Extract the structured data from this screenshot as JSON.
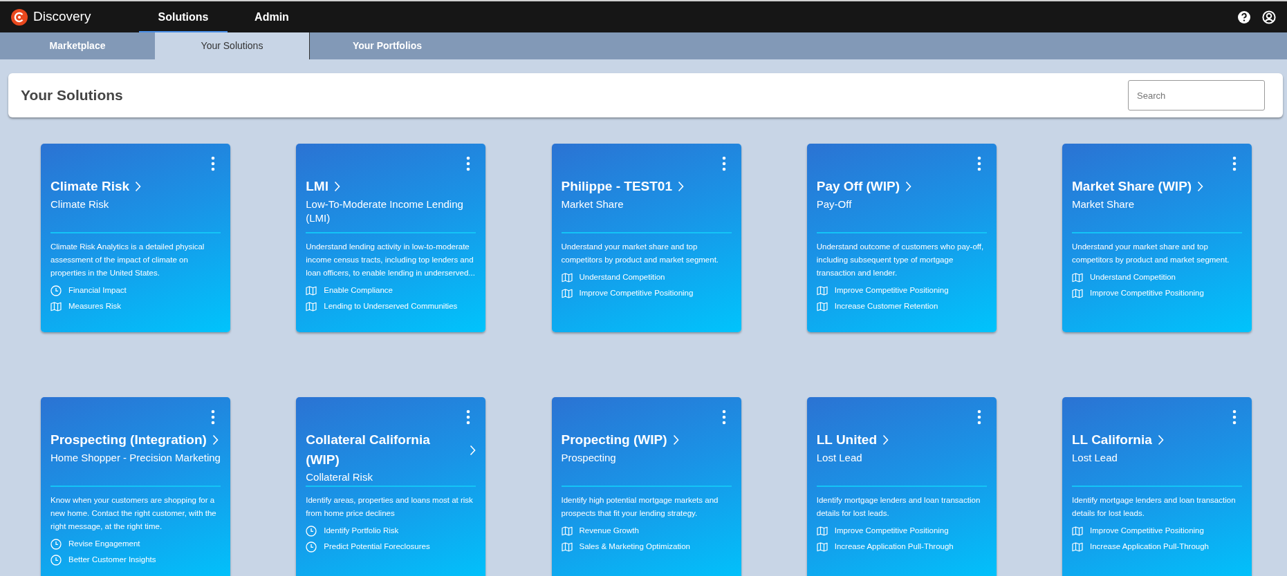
{
  "app": {
    "name": "Discovery"
  },
  "top_nav": [
    {
      "label": "Solutions",
      "selected": true
    },
    {
      "label": "Admin",
      "selected": false
    }
  ],
  "sub_tabs": [
    {
      "label": "Marketplace",
      "selected": false
    },
    {
      "label": "Your Solutions",
      "selected": true
    },
    {
      "label": "Your Portfolios",
      "selected": false
    }
  ],
  "page": {
    "title": "Your Solutions",
    "search": {
      "placeholder": "Search"
    }
  },
  "cards": [
    {
      "title": "Climate Risk",
      "subtitle": "Climate Risk",
      "description": "Climate Risk Analytics is a detailed physical assessment of the impact of climate on properties in the United States.",
      "features": [
        {
          "kind": "clock",
          "label": "Financial Impact"
        },
        {
          "kind": "map",
          "label": "Measures Risk"
        }
      ]
    },
    {
      "title": "LMI",
      "subtitle": "Low-To-Moderate Income Lending (LMI)",
      "description": "Understand lending activity in low-to-moderate income census tracts, including top lenders and loan officers, to enable lending in underserved...",
      "features": [
        {
          "kind": "map",
          "label": "Enable Compliance"
        },
        {
          "kind": "map",
          "label": "Lending to Underserved Communities"
        }
      ]
    },
    {
      "title": "Philippe - TEST01",
      "subtitle": "Market Share",
      "description": "Understand your market share and top competitors by product and market segment.",
      "features": [
        {
          "kind": "map",
          "label": "Understand Competition"
        },
        {
          "kind": "map",
          "label": "Improve Competitive Positioning"
        }
      ]
    },
    {
      "title": "Pay Off (WIP)",
      "subtitle": "Pay-Off",
      "description": "Understand outcome of customers who pay-off, including subsequent type of mortgage transaction and lender.",
      "features": [
        {
          "kind": "map",
          "label": "Improve Competitive Positioning"
        },
        {
          "kind": "map",
          "label": "Increase Customer Retention"
        }
      ]
    },
    {
      "title": "Market Share (WIP)",
      "subtitle": "Market Share",
      "description": "Understand your market share and top competitors by product and market segment.",
      "features": [
        {
          "kind": "map",
          "label": "Understand Competition"
        },
        {
          "kind": "map",
          "label": "Improve Competitive Positioning"
        }
      ]
    },
    {
      "title": "Prospecting (Integration)",
      "subtitle": "Home Shopper - Precision Marketing",
      "description": "Know when your customers are shopping for a new home. Contact the right customer, with the right message, at the right time.",
      "features": [
        {
          "kind": "clock",
          "label": "Revise Engagement"
        },
        {
          "kind": "clock",
          "label": "Better Customer Insights"
        }
      ]
    },
    {
      "title": "Collateral California (WIP)",
      "subtitle": "Collateral Risk",
      "description": "Identify areas, properties and loans most at risk from home price declines",
      "features": [
        {
          "kind": "clock",
          "label": "Identify Portfolio Risk"
        },
        {
          "kind": "clock",
          "label": "Predict Potential Foreclosures"
        }
      ]
    },
    {
      "title": "Propecting (WIP)",
      "subtitle": "Prospecting",
      "description": "Identify high potential mortgage markets and prospects that fit your lending strategy.",
      "features": [
        {
          "kind": "map",
          "label": "Revenue Growth"
        },
        {
          "kind": "map",
          "label": "Sales & Marketing Optimization"
        }
      ]
    },
    {
      "title": "LL United",
      "subtitle": "Lost Lead",
      "description": "Identify mortgage lenders and loan transaction details for lost leads.",
      "features": [
        {
          "kind": "map",
          "label": "Improve Competitive Positioning"
        },
        {
          "kind": "map",
          "label": "Increase Application Pull-Through"
        }
      ]
    },
    {
      "title": "LL California",
      "subtitle": "Lost Lead",
      "description": "Identify mortgage lenders and loan transaction details for lost leads.",
      "features": [
        {
          "kind": "map",
          "label": "Improve Competitive Positioning"
        },
        {
          "kind": "map",
          "label": "Increase Application Pull-Through"
        }
      ]
    }
  ]
}
